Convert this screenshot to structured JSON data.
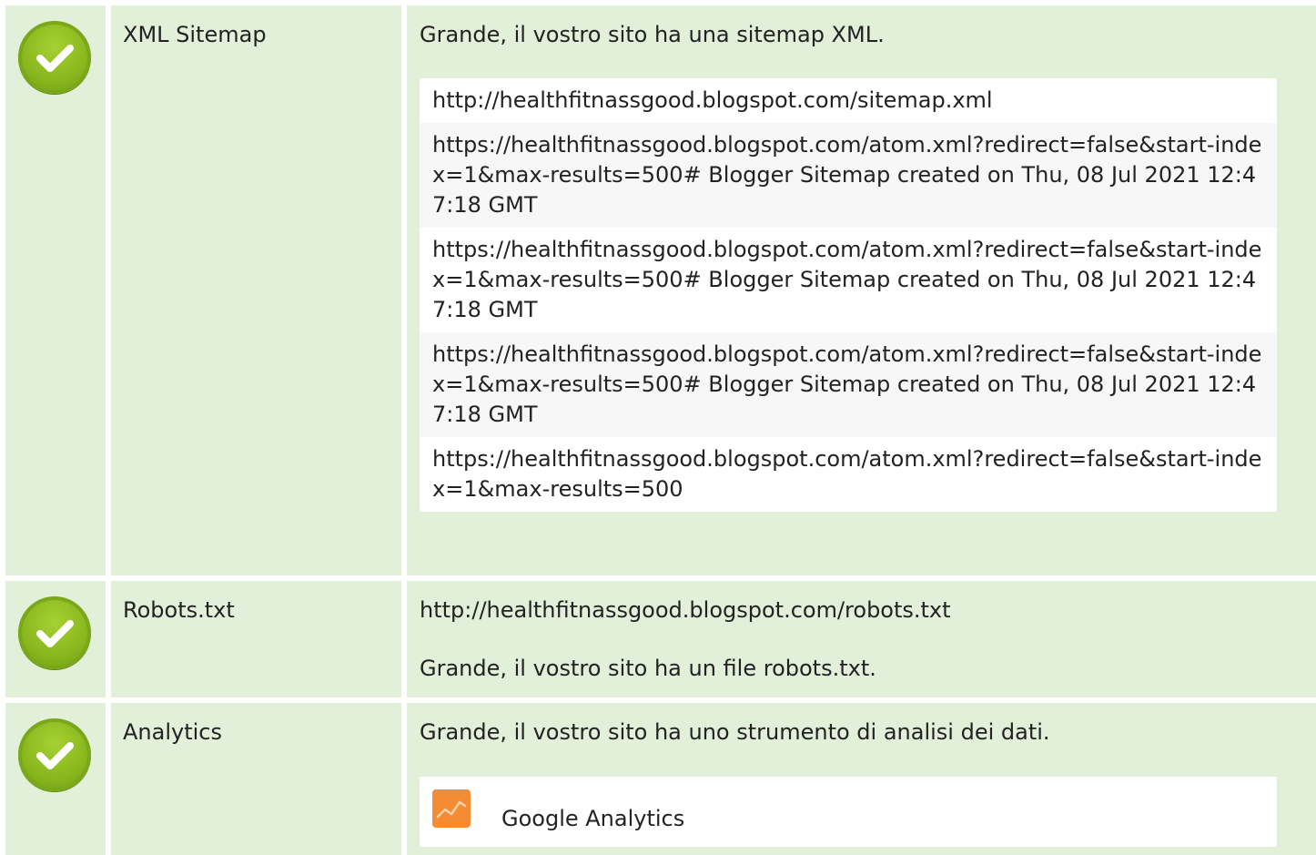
{
  "rows": [
    {
      "title": "XML Sitemap",
      "status": "check-icon",
      "intro": "Grande, il vostro sito ha una sitemap XML.",
      "urls": [
        "http://healthfitnassgood.blogspot.com/sitemap.xml",
        "https://healthfitnassgood.blogspot.com/atom.xml?redirect=false&start-index=1&max-results=500# Blogger Sitemap created on Thu, 08 Jul 2021 12:47:18 GMT",
        "https://healthfitnassgood.blogspot.com/atom.xml?redirect=false&start-index=1&max-results=500# Blogger Sitemap created on Thu, 08 Jul 2021 12:47:18 GMT",
        "https://healthfitnassgood.blogspot.com/atom.xml?redirect=false&start-index=1&max-results=500# Blogger Sitemap created on Thu, 08 Jul 2021 12:47:18 GMT",
        "https://healthfitnassgood.blogspot.com/atom.xml?redirect=false&start-index=1&max-results=500"
      ]
    },
    {
      "title": "Robots.txt",
      "status": "check-icon",
      "url": "http://healthfitnassgood.blogspot.com/robots.txt",
      "message": "Grande, il vostro sito ha un file robots.txt."
    },
    {
      "title": "Analytics",
      "status": "check-icon",
      "intro": "Grande, il vostro sito ha uno strumento di analisi dei dati.",
      "tool": "Google Analytics",
      "tool_icon": "google-analytics-icon"
    }
  ],
  "colors": {
    "row_bg": "#e2efd9",
    "check_green": "#87b51c",
    "ga_orange": "#f58c33"
  }
}
